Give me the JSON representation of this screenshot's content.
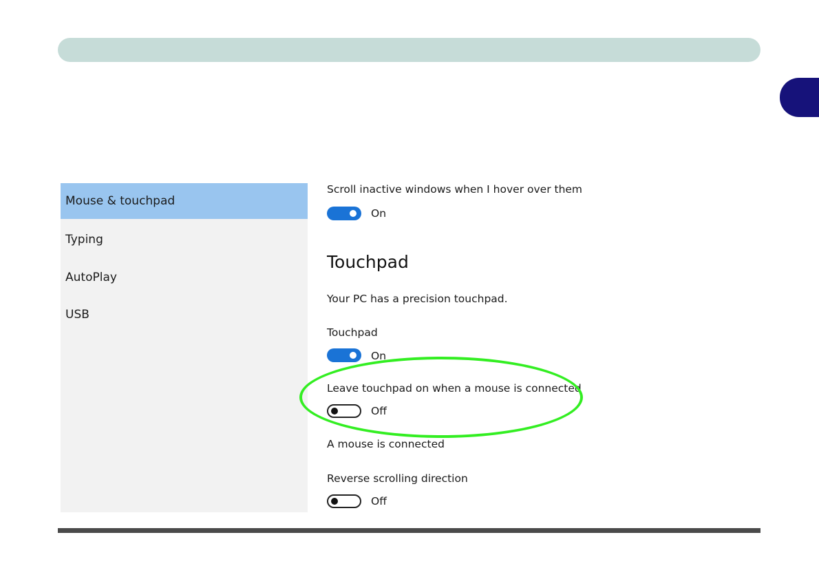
{
  "sidebar": {
    "items": [
      {
        "label": "Mouse & touchpad",
        "selected": true
      },
      {
        "label": "Typing",
        "selected": false
      },
      {
        "label": "AutoPlay",
        "selected": false
      },
      {
        "label": "USB",
        "selected": false
      }
    ]
  },
  "settings": {
    "scroll_inactive": {
      "label": "Scroll inactive windows when I hover over them",
      "state": "On"
    },
    "touchpad_heading": "Touchpad",
    "precision_note": "Your PC has a precision touchpad.",
    "touchpad": {
      "label": "Touchpad",
      "state": "On"
    },
    "leave_on": {
      "label": "Leave touchpad on when a mouse is connected",
      "state": "Off"
    },
    "mouse_note": "A mouse is connected",
    "reverse_scroll": {
      "label": "Reverse scrolling direction",
      "state": "Off"
    }
  },
  "colors": {
    "accent": "#1a73d6",
    "selected_nav": "#99c5ef",
    "highlight": "#33ee22",
    "chapter_tab": "#16127a",
    "header_bar": "#c6dcd8"
  }
}
